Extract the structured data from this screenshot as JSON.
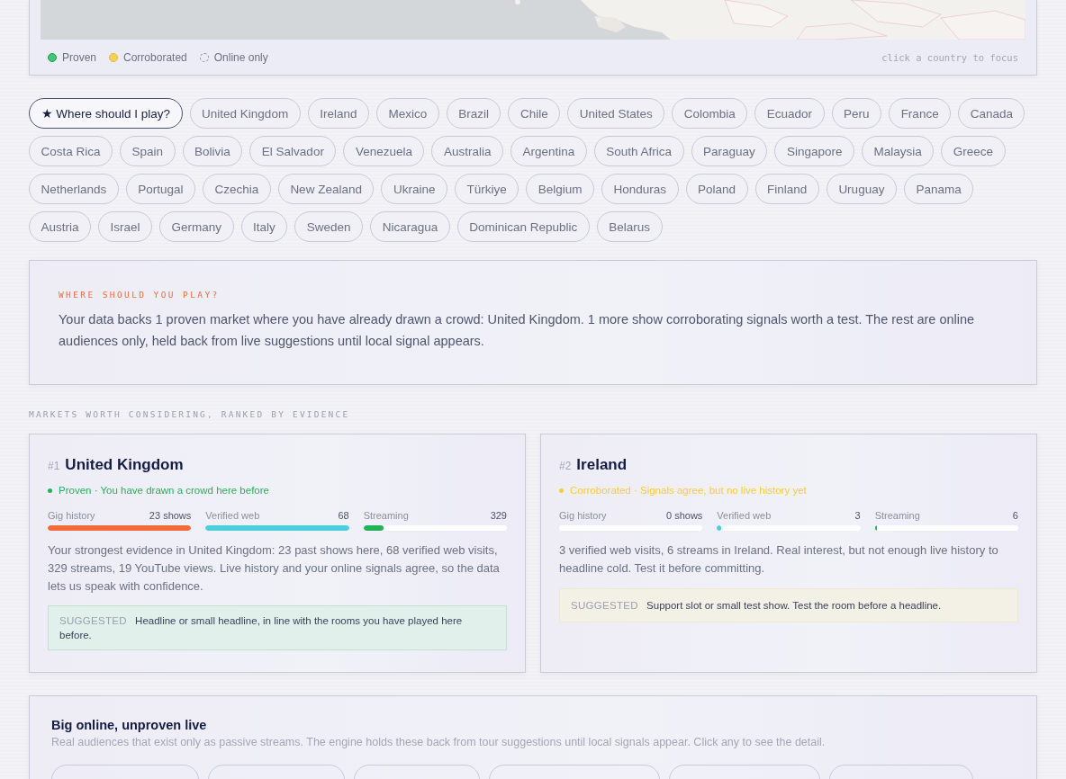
{
  "map": {
    "kind": "picture",
    "legend": [
      {
        "label": "Proven",
        "kind": "proven"
      },
      {
        "label": "Corroborated",
        "kind": "corroborated"
      },
      {
        "label": "Online only",
        "kind": "online"
      }
    ],
    "hint": "click a country to focus"
  },
  "chips": [
    {
      "label": "★ Where should I play?",
      "selected": true
    },
    {
      "label": "United Kingdom",
      "selected": false
    },
    {
      "label": "Ireland",
      "selected": false
    },
    {
      "label": "Mexico",
      "selected": false
    },
    {
      "label": "Brazil",
      "selected": false
    },
    {
      "label": "Chile",
      "selected": false
    },
    {
      "label": "United States",
      "selected": false
    },
    {
      "label": "Colombia",
      "selected": false
    },
    {
      "label": "Ecuador",
      "selected": false
    },
    {
      "label": "Peru",
      "selected": false
    },
    {
      "label": "France",
      "selected": false
    },
    {
      "label": "Canada",
      "selected": false
    },
    {
      "label": "Costa Rica",
      "selected": false
    },
    {
      "label": "Spain",
      "selected": false
    },
    {
      "label": "Bolivia",
      "selected": false
    },
    {
      "label": "El Salvador",
      "selected": false
    },
    {
      "label": "Venezuela",
      "selected": false
    },
    {
      "label": "Australia",
      "selected": false
    },
    {
      "label": "Argentina",
      "selected": false
    },
    {
      "label": "South Africa",
      "selected": false
    },
    {
      "label": "Paraguay",
      "selected": false
    },
    {
      "label": "Singapore",
      "selected": false
    },
    {
      "label": "Malaysia",
      "selected": false
    },
    {
      "label": "Greece",
      "selected": false
    },
    {
      "label": "Netherlands",
      "selected": false
    },
    {
      "label": "Portugal",
      "selected": false
    },
    {
      "label": "Czechia",
      "selected": false
    },
    {
      "label": "New Zealand",
      "selected": false
    },
    {
      "label": "Ukraine",
      "selected": false
    },
    {
      "label": "Türkiye",
      "selected": false
    },
    {
      "label": "Belgium",
      "selected": false
    },
    {
      "label": "Honduras",
      "selected": false
    },
    {
      "label": "Poland",
      "selected": false
    },
    {
      "label": "Finland",
      "selected": false
    },
    {
      "label": "Uruguay",
      "selected": false
    },
    {
      "label": "Panama",
      "selected": false
    },
    {
      "label": "Austria",
      "selected": false
    },
    {
      "label": "Israel",
      "selected": false
    },
    {
      "label": "Germany",
      "selected": false
    },
    {
      "label": "Italy",
      "selected": false
    },
    {
      "label": "Sweden",
      "selected": false
    },
    {
      "label": "Nicaragua",
      "selected": false
    },
    {
      "label": "Dominican Republic",
      "selected": false
    },
    {
      "label": "Belarus",
      "selected": false
    }
  ],
  "summary": {
    "eyebrow": "WHERE SHOULD YOU PLAY?",
    "text": "Your data backs 1 proven market where you have already drawn a crowd: United Kingdom. 1 more show corroborating signals worth a test. The rest are online audiences only, held back from live suggestions until local signal appears."
  },
  "section_label": "MARKETS WORTH CONSIDERING, RANKED BY EVIDENCE",
  "markets": [
    {
      "rank": "#1",
      "name": "United Kingdom",
      "kind": "proven",
      "status": "Proven · You have drawn a crowd here before",
      "metrics": [
        {
          "label": "Gig history",
          "value": "23 shows",
          "level": 1.0
        },
        {
          "label": "Verified web",
          "value": "68",
          "level": 1.0
        },
        {
          "label": "Streaming",
          "value": "329",
          "level": 0.14
        }
      ],
      "text": "Your strongest evidence in United Kingdom: 23 past shows here, 68 verified web visits, 329 streams, 19 YouTube views. Live history and your online signals agree, so the data lets us speak with confidence.",
      "suggested_label": "SUGGESTED",
      "suggestion": "Headline or small headline, in line with the rooms you have played here before."
    },
    {
      "rank": "#2",
      "name": "Ireland",
      "kind": "corroborated",
      "status": "Corroborated · Signals agree, but no live history yet",
      "metrics": [
        {
          "label": "Gig history",
          "value": "0 shows",
          "level": 0
        },
        {
          "label": "Verified web",
          "value": "3",
          "level": 0.03
        },
        {
          "label": "Streaming",
          "value": "6",
          "level": 0.005
        }
      ],
      "text": "3 verified web visits, 6 streams in Ireland. Real interest, but not enough live history to headline cold. Test it before committing.",
      "suggested_label": "SUGGESTED",
      "suggestion": "Support slot or small test show. Test the room before a headline."
    }
  ],
  "online": {
    "title": "Big online, unproven live",
    "text": "Real audiences that exist only as passive streams. The engine holds these back from tour suggestions until local signals appear. Click any to see the detail."
  }
}
